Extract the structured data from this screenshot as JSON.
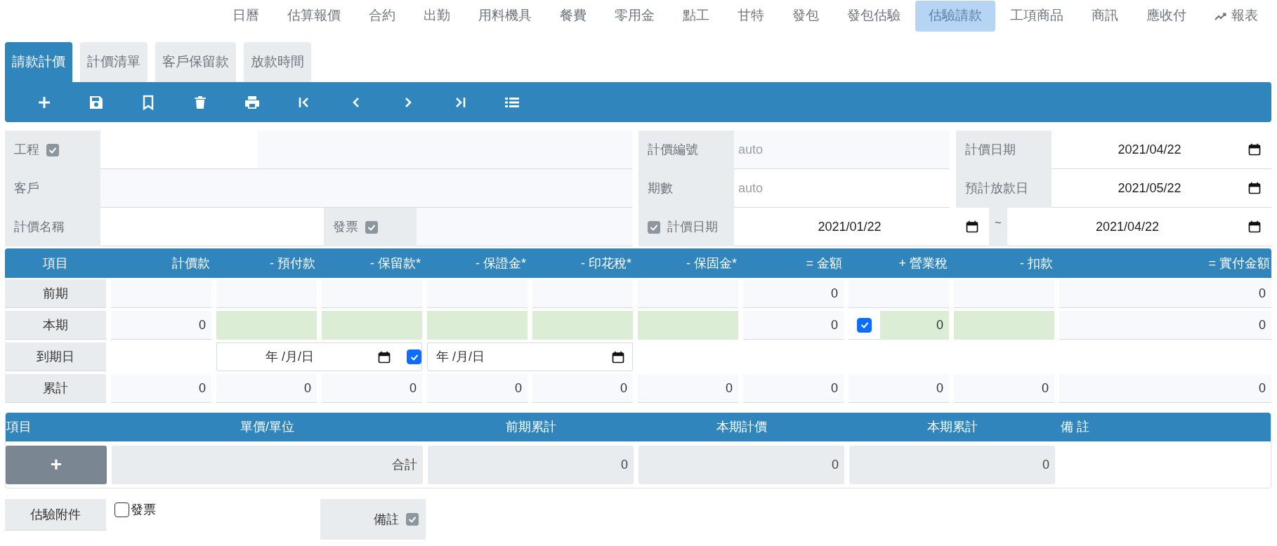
{
  "nav": [
    {
      "label": "日曆",
      "selected": false,
      "kind": "text"
    },
    {
      "label": "估算報價",
      "selected": false,
      "kind": "text"
    },
    {
      "label": "合約",
      "selected": false,
      "kind": "text"
    },
    {
      "label": "出勤",
      "selected": false,
      "kind": "text"
    },
    {
      "label": "用料機具",
      "selected": false,
      "kind": "text"
    },
    {
      "label": "餐費",
      "selected": false,
      "kind": "text"
    },
    {
      "label": "零用金",
      "selected": false,
      "kind": "text"
    },
    {
      "label": "點工",
      "selected": false,
      "kind": "text"
    },
    {
      "label": "甘特",
      "selected": false,
      "kind": "text"
    },
    {
      "label": "發包",
      "selected": false,
      "kind": "text"
    },
    {
      "label": "發包估驗",
      "selected": false,
      "kind": "text"
    },
    {
      "label": "估驗請款",
      "selected": true,
      "kind": "text"
    },
    {
      "label": "工項商品",
      "selected": false,
      "kind": "text"
    },
    {
      "label": "商訊",
      "selected": false,
      "kind": "text"
    },
    {
      "label": "應收付",
      "selected": false,
      "kind": "text"
    },
    {
      "label": "報表",
      "selected": false,
      "kind": "report"
    }
  ],
  "tabs": [
    {
      "label": "請款計價",
      "selected": true
    },
    {
      "label": "計價清單",
      "selected": false
    },
    {
      "label": "客戶保留款",
      "selected": false
    },
    {
      "label": "放款時間",
      "selected": false
    }
  ],
  "form": {
    "project": {
      "label": "工程",
      "checked": true
    },
    "customer": {
      "label": "客戶"
    },
    "billing_name": {
      "label": "計價名稱"
    },
    "invoice": {
      "label": "發票",
      "checked": true
    },
    "billing_no": {
      "label": "計價編號",
      "placeholder": "auto"
    },
    "period_no": {
      "label": "期數",
      "placeholder": "auto"
    },
    "billing_period": {
      "label": "計價日期",
      "checked": true,
      "from": "2021/01/22",
      "separator": "~",
      "to": "2021/04/22"
    },
    "billing_date": {
      "label": "計價日期",
      "value": "2021/04/22"
    },
    "expected_payment_date": {
      "label": "預計放款日",
      "value": "2021/05/22"
    }
  },
  "summary": {
    "columns": [
      "項目",
      "計價款",
      "- 預付款",
      "- 保留款*",
      "- 保證金*",
      "- 印花稅*",
      "- 保固金*",
      "= 金額",
      "+ 營業稅",
      "- 扣款",
      "= 實付金額"
    ],
    "rows": [
      {
        "cells": [
          {
            "kind": "label",
            "value": "前期"
          },
          {
            "kind": "value"
          },
          {
            "kind": "value"
          },
          {
            "kind": "value"
          },
          {
            "kind": "value"
          },
          {
            "kind": "value"
          },
          {
            "kind": "value"
          },
          {
            "kind": "value",
            "value": "0"
          },
          {
            "kind": "value"
          },
          {
            "kind": "value"
          },
          {
            "kind": "value",
            "value": "0"
          }
        ]
      },
      {
        "cells": [
          {
            "kind": "label",
            "value": "本期"
          },
          {
            "kind": "value",
            "value": "0"
          },
          {
            "kind": "input"
          },
          {
            "kind": "input"
          },
          {
            "kind": "input"
          },
          {
            "kind": "input"
          },
          {
            "kind": "input"
          },
          {
            "kind": "value",
            "value": "0"
          },
          {
            "kind": "tax",
            "checked": true,
            "value": "0"
          },
          {
            "kind": "input"
          },
          {
            "kind": "value",
            "value": "0"
          }
        ]
      },
      {
        "cells": [
          {
            "kind": "label",
            "value": "到期日"
          },
          {
            "kind": "blank"
          },
          {
            "kind": "date_check",
            "placeholder": "年 /月/日",
            "checked": true
          },
          {
            "kind": "date",
            "placeholder": "年 /月/日"
          },
          {
            "kind": "blank"
          },
          {
            "kind": "blank"
          },
          {
            "kind": "blank"
          },
          {
            "kind": "blank"
          },
          {
            "kind": "blank"
          }
        ]
      },
      {
        "cells": [
          {
            "kind": "label",
            "value": "累計"
          },
          {
            "kind": "value",
            "value": "0"
          },
          {
            "kind": "value",
            "value": "0"
          },
          {
            "kind": "value",
            "value": "0"
          },
          {
            "kind": "value",
            "value": "0"
          },
          {
            "kind": "value",
            "value": "0"
          },
          {
            "kind": "value",
            "value": "0"
          },
          {
            "kind": "value",
            "value": "0"
          },
          {
            "kind": "value",
            "value": "0"
          },
          {
            "kind": "value",
            "value": "0"
          },
          {
            "kind": "value",
            "value": "0"
          }
        ]
      }
    ]
  },
  "items": {
    "columns": [
      "項目",
      "單價/單位",
      "前期累計",
      "本期計價",
      "本期累計",
      "備 註"
    ],
    "add_button": "+",
    "total": {
      "label": "合計",
      "previous": "0",
      "current": "0",
      "cumulative": "0"
    }
  },
  "footer": {
    "attachment_button": "估驗附件",
    "invoice": {
      "label": "發票",
      "checked": false
    },
    "remarks": {
      "label": "備註",
      "checked": true
    }
  }
}
